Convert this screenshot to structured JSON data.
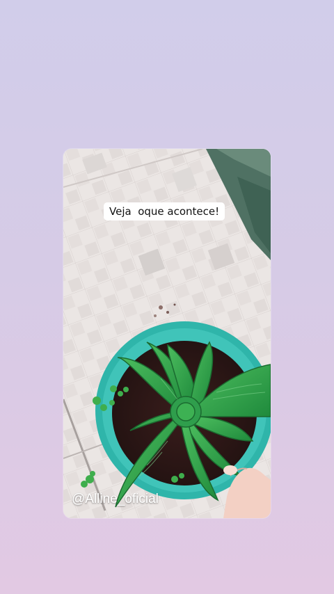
{
  "story": {
    "caption": "Veja  oque acontece!",
    "handle": "@Alline_oficial"
  },
  "photo": {
    "subject": "snake plant in a teal pot on a tiled floor",
    "pot_color": "#3cc0b5",
    "leaf_color": "#2f9e4c"
  },
  "icons": [
    "plant-photo"
  ]
}
